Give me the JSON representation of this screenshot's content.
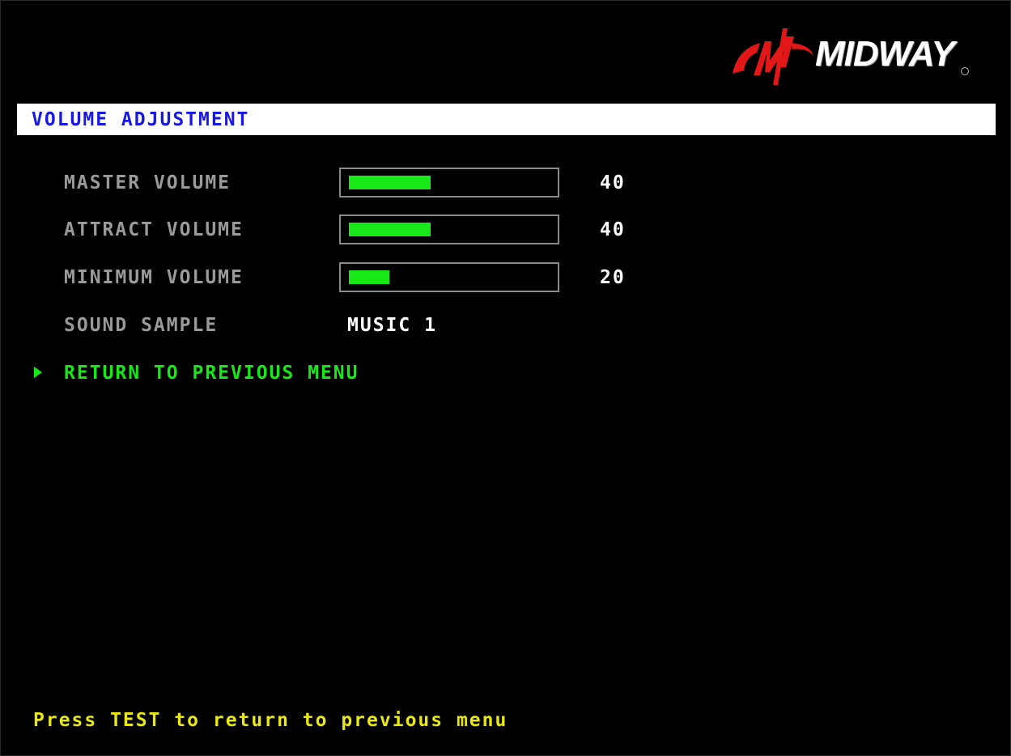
{
  "brand": {
    "logo_text": "MIDWAY",
    "logo_icon": "midway-m-logo",
    "logo_color": "#e21818"
  },
  "header": {
    "title": "VOLUME ADJUSTMENT"
  },
  "settings": [
    {
      "label": "MASTER VOLUME",
      "value": "40",
      "level": 0.4
    },
    {
      "label": "ATTRACT VOLUME",
      "value": "40",
      "level": 0.4
    },
    {
      "label": "MINIMUM VOLUME",
      "value": "20",
      "level": 0.2
    }
  ],
  "sound_sample": {
    "label": "SOUND SAMPLE",
    "value": "MUSIC 1"
  },
  "menu": {
    "cursor_icon": "triangle-right-icon",
    "return_label": "RETURN TO PREVIOUS MENU"
  },
  "footer": {
    "hint": "Press TEST to return to previous menu"
  },
  "colors": {
    "background": "#000000",
    "title_bg": "#ffffff",
    "title_text": "#1818e0",
    "label": "#9a9a9a",
    "value": "#ffffff",
    "bar_fill": "#18e818",
    "menu_selected": "#18e818",
    "footer": "#e8e818"
  }
}
